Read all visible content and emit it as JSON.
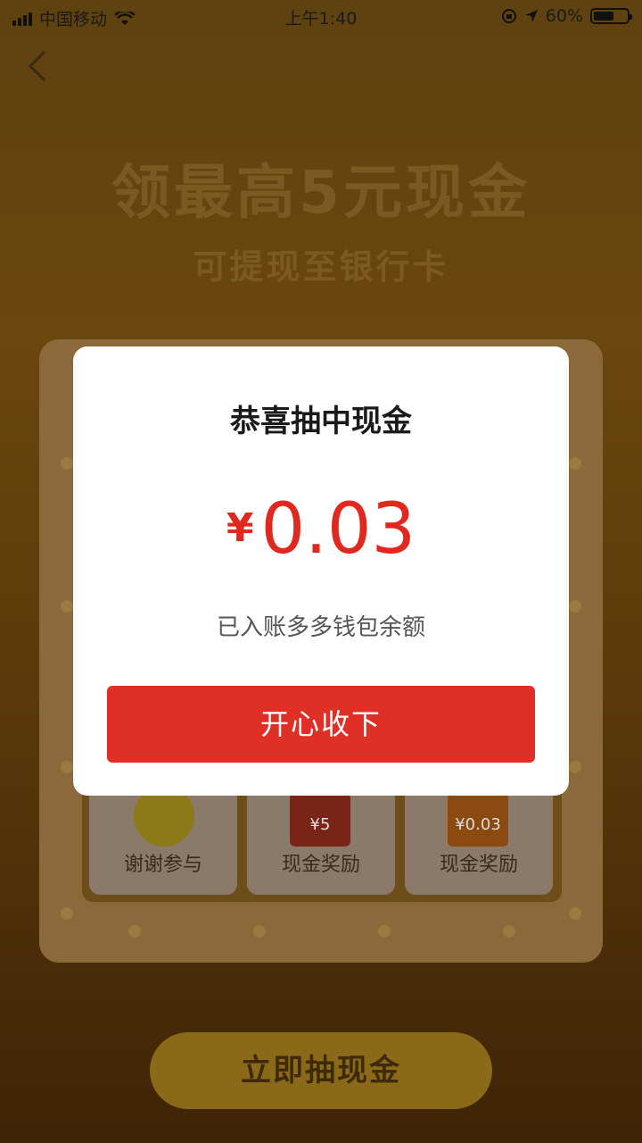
{
  "status_bar": {
    "carrier": "中国移动",
    "time": "上午1:40",
    "battery_percent": "60%"
  },
  "page": {
    "headline": "领最高5元现金",
    "subheadline": "可提现至银行卡",
    "draw_button_label": "立即抽现金"
  },
  "prizes": [
    {
      "label": "谢谢参与",
      "icon": "smiley-icon"
    },
    {
      "label": "现金奖励",
      "amount": "¥5",
      "icon": "red-envelope-icon"
    },
    {
      "label": "现金奖励",
      "amount": "¥0.03",
      "icon": "red-envelope-icon"
    }
  ],
  "modal": {
    "title": "恭喜抽中现金",
    "currency_symbol": "¥",
    "amount": "0.03",
    "note": "已入账多多钱包余额",
    "accept_label": "开心收下"
  },
  "colors": {
    "accent_red": "#e02f26",
    "amount_red": "#e0281e"
  }
}
